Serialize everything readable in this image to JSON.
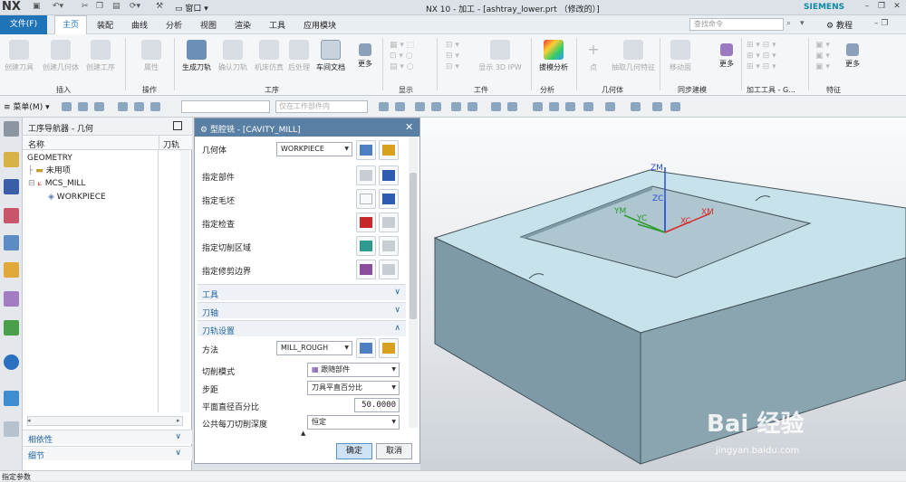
{
  "titlebar": {
    "logo": "NX",
    "window_menu": "窗口",
    "title": "NX 10 - 加工 - [ashtray_lower.prt （修改的）]",
    "brand": "SIEMENS"
  },
  "menubar": {
    "file": "文件(F)",
    "tabs": [
      "主页",
      "装配",
      "曲线",
      "分析",
      "视图",
      "渲染",
      "工具",
      "应用模块"
    ],
    "active": "主页",
    "search_placeholder": "查找命令",
    "tutorial": "教程"
  },
  "ribbon": {
    "buttons": [
      "创建刀具",
      "创建几何体",
      "创建工序",
      "属性",
      "生成刀轨",
      "确认刀轨",
      "机床仿真",
      "后处理",
      "车间文档",
      "更多",
      "显示 3D IPW",
      "拔模分析",
      "点",
      "抽取几何特征",
      "移动面",
      "更多",
      "更多"
    ],
    "groups": [
      "插入",
      "操作",
      "工序",
      "显示",
      "工件",
      "分析",
      "几何体",
      "同步建模",
      "加工工具 - G...",
      "特征"
    ]
  },
  "toolbar2": {
    "menu": "菜单(M)",
    "filter_placeholder": "仅在工作部件内"
  },
  "navigator": {
    "title": "工序导航器 - 几何",
    "col_name": "名称",
    "col_tool": "刀轨",
    "rows": [
      "GEOMETRY",
      "未用项",
      "MCS_MILL",
      "WORKPIECE"
    ],
    "sections": [
      "相依性",
      "细节"
    ]
  },
  "dialog": {
    "title": "型腔铣 - [CAVITY_MILL]",
    "geometry_label": "几何体",
    "geometry_value": "WORKPIECE",
    "fields": [
      "指定部件",
      "指定毛坯",
      "指定检查",
      "指定切削区域",
      "指定修剪边界"
    ],
    "sections": [
      "工具",
      "刀轴",
      "刀轨设置"
    ],
    "method_label": "方法",
    "method_value": "MILL_ROUGH",
    "cut_pattern_label": "切削模式",
    "cut_pattern_value": "跟随部件",
    "stepover_label": "步距",
    "stepover_value": "刀具平直百分比",
    "flat_pct_label": "平面直径百分比",
    "flat_pct_value": "50.0000",
    "depth_label": "公共每刀切削深度",
    "depth_value": "恒定",
    "ok": "确定",
    "cancel": "取消"
  },
  "viewport": {
    "axes": [
      "ZM",
      "ZC",
      "YM",
      "YC",
      "XC",
      "XM"
    ]
  },
  "status": {
    "text": "指定参数"
  },
  "watermark": {
    "main": "Bai 经验",
    "sub": "jingyan.baidu.com"
  },
  "colors": {
    "accent": "#1f74b8",
    "dialog_header": "#5a7fa4",
    "part_top": "#c7e2ea",
    "part_side": "#7d9aa6"
  }
}
